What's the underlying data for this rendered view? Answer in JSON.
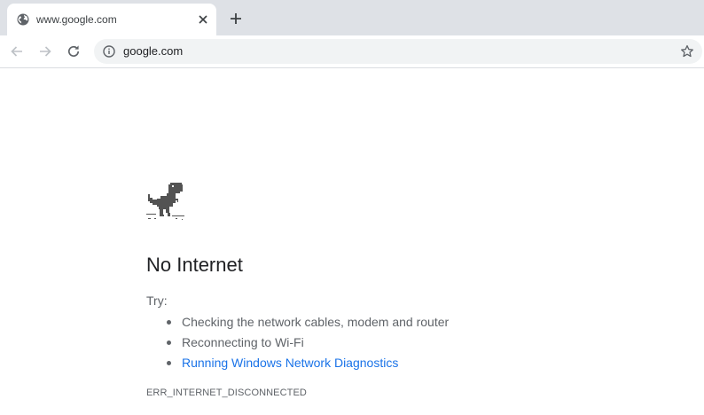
{
  "tab": {
    "title": "www.google.com",
    "favicon": "globe-icon",
    "close": "close-icon"
  },
  "newtab": "plus-icon",
  "toolbar": {
    "back": "arrow-left-icon",
    "forward": "arrow-right-icon",
    "reload": "reload-icon"
  },
  "omnibox": {
    "url": "google.com",
    "info": "info-icon",
    "bookmark": "star-icon"
  },
  "error_page": {
    "icon": "dino-icon",
    "heading": "No Internet",
    "try_label": "Try:",
    "suggestions": [
      "Checking the network cables, modem and router",
      "Reconnecting to Wi-Fi",
      "Running Windows Network Diagnostics"
    ],
    "error_code": "ERR_INTERNET_DISCONNECTED"
  },
  "colors": {
    "tabstrip_bg": "#dee1e6",
    "omnibox_bg": "#f1f3f4",
    "link": "#1a73e8",
    "text": "#5f6368",
    "heading": "#202124"
  }
}
